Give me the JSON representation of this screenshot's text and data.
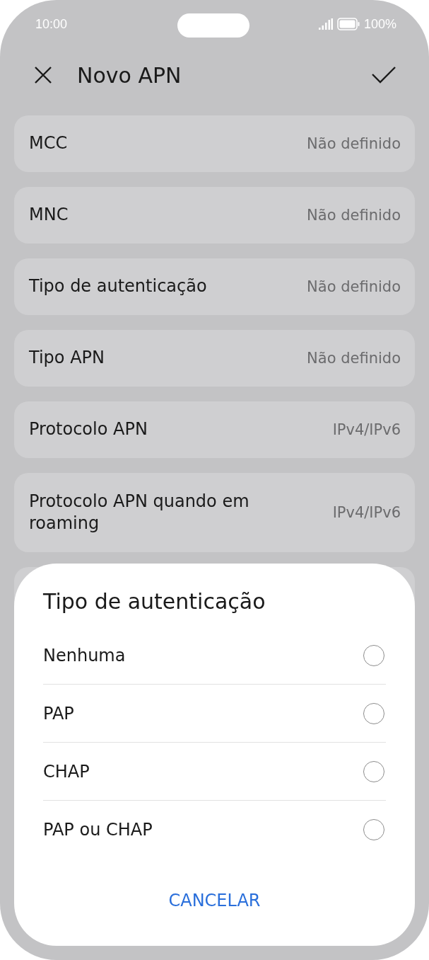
{
  "status_bar": {
    "time": "10:00",
    "battery": "100%"
  },
  "header": {
    "title": "Novo APN"
  },
  "settings": [
    {
      "label": "MCC",
      "value": "Não definido"
    },
    {
      "label": "MNC",
      "value": "Não definido"
    },
    {
      "label": "Tipo de autenticação",
      "value": "Não definido"
    },
    {
      "label": "Tipo APN",
      "value": "Não definido"
    },
    {
      "label": "Protocolo APN",
      "value": "IPv4/IPv6"
    },
    {
      "label": "Protocolo APN quando em roaming",
      "value": "IPv4/IPv6"
    }
  ],
  "dialog": {
    "title": "Tipo de autenticação",
    "options": [
      {
        "label": "Nenhuma",
        "selected": false
      },
      {
        "label": "PAP",
        "selected": false
      },
      {
        "label": "CHAP",
        "selected": false
      },
      {
        "label": "PAP ou CHAP",
        "selected": false
      }
    ],
    "cancel": "CANCELAR"
  }
}
